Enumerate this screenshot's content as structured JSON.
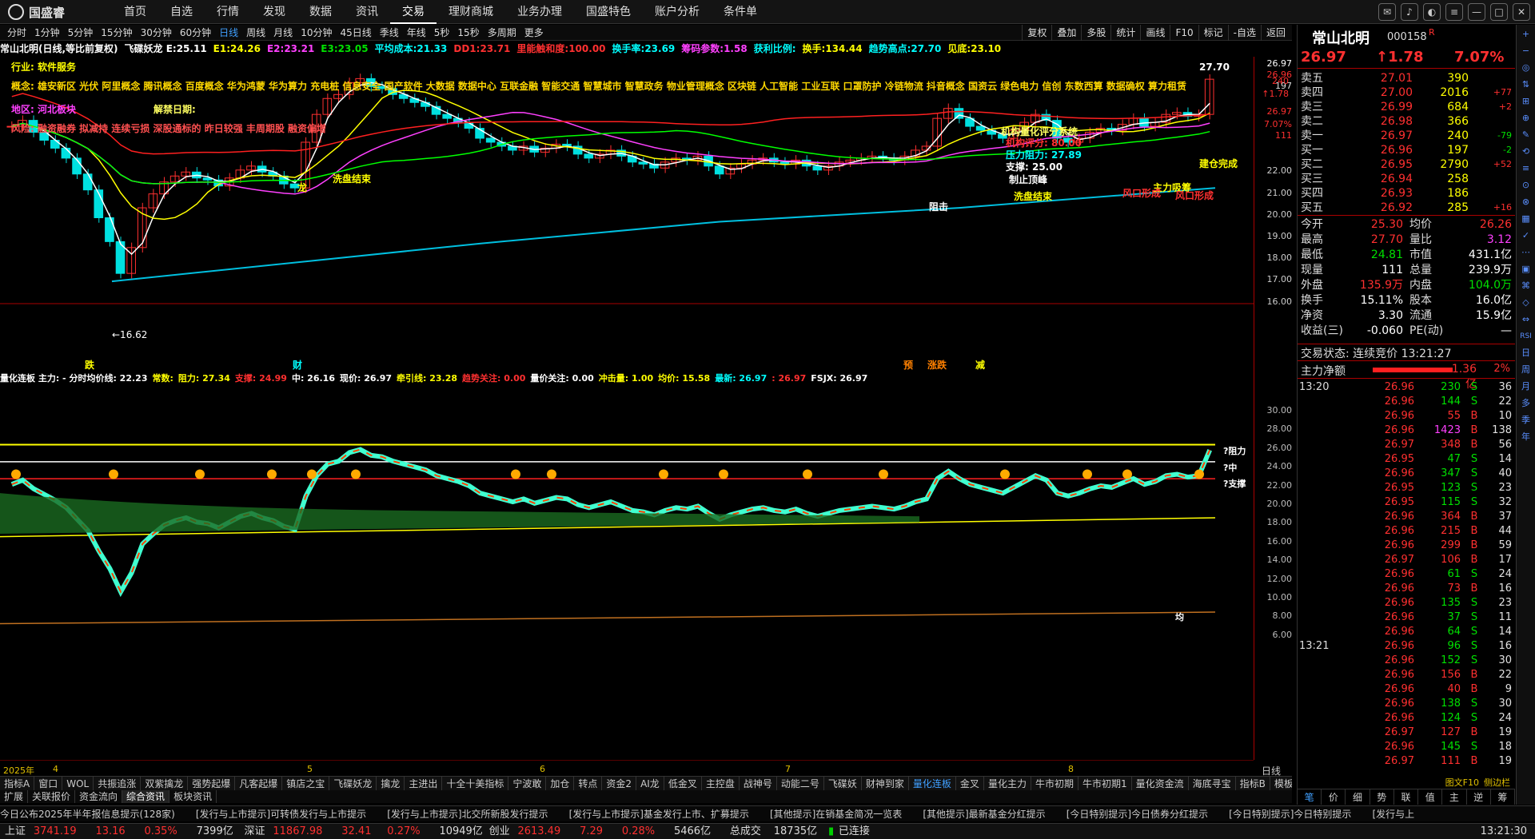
{
  "app": {
    "logo": "国盛睿",
    "menu": [
      "首页",
      "自选",
      "行情",
      "发现",
      "数据",
      "资讯",
      "交易",
      "理财商城",
      "业务办理",
      "国盛特色",
      "账户分析",
      "条件单"
    ],
    "active_menu": 6
  },
  "periods": [
    "分时",
    "1分钟",
    "5分钟",
    "15分钟",
    "30分钟",
    "60分钟",
    "日线",
    "周线",
    "月线",
    "10分钟",
    "45日线",
    "季线",
    "年线",
    "5秒",
    "15秒",
    "多周期",
    "更多"
  ],
  "active_period": 6,
  "tools": [
    "复权",
    "叠加",
    "多股",
    "统计",
    "画线",
    "F10",
    "标记",
    "-自选",
    "返回"
  ],
  "infobar": [
    {
      "t": "常山北明(日线,等比前复权)",
      "c": "wht"
    },
    {
      "t": "飞碟妖龙 E:25.11",
      "c": "wht"
    },
    {
      "t": "E1:24.26",
      "c": "yel"
    },
    {
      "t": "E2:23.21",
      "c": "mag"
    },
    {
      "t": "E3:23.05",
      "c": "grn"
    },
    {
      "t": "平均成本:21.33",
      "c": "cyn"
    },
    {
      "t": "DD1:23.71",
      "c": "red"
    },
    {
      "t": "里能触和度:100.00",
      "c": "red"
    },
    {
      "t": "换手率:23.69",
      "c": "cyn"
    },
    {
      "t": "筹码参数:1.58",
      "c": "mag"
    },
    {
      "t": "获利比例:",
      "c": "cyn"
    },
    {
      "t": "换手:134.44",
      "c": "yel"
    },
    {
      "t": "趋势高点:27.70",
      "c": "cyn"
    },
    {
      "t": "见底:23.10",
      "c": "yel"
    }
  ],
  "annotations": {
    "industry": "行业: 软件服务",
    "concept": "概念: 雄安新区 光伏 阿里概念 腾讯概念 百度概念 华为鸿蒙 华为算力 充电桩 信息安全 国产软件 大数据 数据中心 互联金融 智能交通 智慧城市 智慧政务 物业管理概念 区块链 人工智能 工业互联 口罩防护 冷链物流 抖音概念 国资云 绿色电力 信创 东数西算 数据确权 算力租赁",
    "region": "地区: 河北板块",
    "risk": "风险: 融资融券 拟减持 连续亏损 深股通标的 昨日较强 丰周期股 融资偏增",
    "jiedu": "解禁日期:",
    "xipan1": "洗盘结束",
    "xipan2": "洗盘结束",
    "zhengu": "阻击",
    "zhuli": "主力吸筹",
    "jiancang": "建仓完成",
    "fengkou1": "风口形成",
    "fengkou2": "风口形成",
    "longhu": "龙",
    "sys_title": "机构量化评分系统",
    "sys_score": "机构评分: 80.00",
    "sys_resist": "压力阻力: 27.89",
    "sys_support": "支撑: 25.00",
    "sys_peak": "制止顶峰",
    "hi_label": "27.70",
    "lo_label": "←16.62",
    "markers": [
      "跌",
      "财",
      "预",
      "涨跌",
      "减"
    ]
  },
  "price_axis": [
    "26.97",
    "26.96",
    "197",
    "26.97",
    "7.07%",
    "111",
    "22.00",
    "21.00",
    "20.00",
    "19.00",
    "18.00",
    "17.00",
    "16.00"
  ],
  "top_axis": [
    "240",
    "↑1.78"
  ],
  "sub_axis": [
    "30.00",
    "28.00",
    "26.00",
    "24.00",
    "22.00",
    "20.00",
    "18.00",
    "16.00",
    "14.00",
    "12.00",
    "10.00",
    "8.00",
    "6.00"
  ],
  "subinfo": [
    {
      "t": "量化连板 主力: - 分时均价线: 22.23",
      "c": "wht"
    },
    {
      "t": "常数:",
      "c": "yel"
    },
    {
      "t": "阻力: 27.34",
      "c": "yel"
    },
    {
      "t": "支撑: 24.99",
      "c": "red"
    },
    {
      "t": "中: 26.16",
      "c": "wht"
    },
    {
      "t": "现价: 26.97",
      "c": "wht"
    },
    {
      "t": "牵引线: 23.28",
      "c": "yel"
    },
    {
      "t": "趋势关注: 0.00",
      "c": "red"
    },
    {
      "t": "量价关注: 0.00",
      "c": "wht"
    },
    {
      "t": "冲击量: 1.00",
      "c": "yel"
    },
    {
      "t": "均价: 15.58",
      "c": "yel"
    },
    {
      "t": "最新: 26.97",
      "c": "cyn"
    },
    {
      "t": ": 26.97",
      "c": "red"
    },
    {
      "t": "FSJX: 26.97",
      "c": "wht"
    }
  ],
  "sub_labels": {
    "resist": "阻力",
    "mid": "中",
    "support": "支撑",
    "avg": "均"
  },
  "dates": [
    "2025年",
    "4",
    "5",
    "6",
    "7",
    "8"
  ],
  "indtabs": [
    "指标A",
    "窗口",
    "WOL",
    "共振追涨",
    "双紫擒龙",
    "强势起爆",
    "凡客起爆",
    "镇店之宝",
    "飞碟妖龙",
    "擒龙",
    "主进出",
    "十全十美指标",
    "宁波敢",
    "加仓",
    "转点",
    "资金2",
    "AI龙",
    "低金叉",
    "主控盘",
    "战神号",
    "动能二号",
    "飞碟妖",
    "财神到家",
    "量化连板",
    "金叉",
    "量化主力",
    "牛市初期",
    "牛市初期1",
    "量化资金流",
    "海底寻宝",
    "指标B",
    "模板"
  ],
  "active_ind": 23,
  "bottabs": [
    "扩展",
    "关联报价",
    "资金流向",
    "综合资讯",
    "板块资讯"
  ],
  "active_bottab": 3,
  "news": [
    "今日公布2025年半年报信息提示(128家)",
    "[发行与上市提示]可转债发行与上市提示",
    "[发行与上市提示]北交所新股发行提示",
    "[发行与上市提示]基金发行上市、扩募提示",
    "[其他提示]在销基金简况一览表",
    "[其他提示]最新基金分红提示",
    "[今日特别提示]今日债券分红提示",
    "[今日特别提示]今日特别提示",
    "[发行与上"
  ],
  "status": {
    "sh_name": "上证",
    "sh_val": "3741.19",
    "sh_chg": "13.16",
    "sh_pct": "0.35%",
    "sh_amt": "7399亿",
    "sz_name": "深证",
    "sz_val": "11867.98",
    "sz_chg": "32.41",
    "sz_pct": "0.27%",
    "sz_amt": "10949亿",
    "cy_name": "创业",
    "cy_val": "2613.49",
    "cy_chg": "7.29",
    "cy_pct": "0.28%",
    "cy_amt": "5466亿",
    "total_name": "总成交",
    "total_amt": "18735亿",
    "conn": "已连接",
    "time": "13:21:30"
  },
  "quote": {
    "name": "常山北明",
    "code": "000158",
    "flag": "R",
    "price": "26.97",
    "chg": "↑1.78",
    "pct": "7.07%"
  },
  "orderbook": [
    {
      "l": "卖五",
      "p": "27.01",
      "v": "390",
      "d": ""
    },
    {
      "l": "卖四",
      "p": "27.00",
      "v": "2016",
      "d": "+77"
    },
    {
      "l": "卖三",
      "p": "26.99",
      "v": "684",
      "d": "+2"
    },
    {
      "l": "卖二",
      "p": "26.98",
      "v": "366",
      "d": ""
    },
    {
      "l": "卖一",
      "p": "26.97",
      "v": "240",
      "d": "-79"
    },
    {
      "l": "买一",
      "p": "26.96",
      "v": "197",
      "d": "-2"
    },
    {
      "l": "买二",
      "p": "26.95",
      "v": "2790",
      "d": "+52"
    },
    {
      "l": "买三",
      "p": "26.94",
      "v": "258",
      "d": ""
    },
    {
      "l": "买四",
      "p": "26.93",
      "v": "186",
      "d": ""
    },
    {
      "l": "买五",
      "p": "26.92",
      "v": "285",
      "d": "+16"
    }
  ],
  "stats": [
    {
      "k1": "今开",
      "v1": "25.30",
      "c1": "red",
      "k2": "均价",
      "v2": "26.26",
      "c2": "red"
    },
    {
      "k1": "最高",
      "v1": "27.70",
      "c1": "red",
      "k2": "量比",
      "v2": "3.12",
      "c2": "mag"
    },
    {
      "k1": "最低",
      "v1": "24.81",
      "c1": "grn",
      "k2": "市值",
      "v2": "431.1亿",
      "c2": "wht"
    },
    {
      "k1": "现量",
      "v1": "111",
      "c1": "wht",
      "k2": "总量",
      "v2": "239.9万",
      "c2": "wht"
    },
    {
      "k1": "外盘",
      "v1": "135.9万",
      "c1": "red",
      "k2": "内盘",
      "v2": "104.0万",
      "c2": "grn"
    },
    {
      "k1": "换手",
      "v1": "15.11%",
      "c1": "wht",
      "k2": "股本",
      "v2": "16.0亿",
      "c2": "wht"
    },
    {
      "k1": "净资",
      "v1": "3.30",
      "c1": "wht",
      "k2": "流通",
      "v2": "15.9亿",
      "c2": "wht"
    },
    {
      "k1": "收益(三)",
      "v1": "-0.060",
      "c1": "wht",
      "k2": "PE(动)",
      "v2": "—",
      "c2": "wht"
    }
  ],
  "trade_state": "交易状态: 连续竞价 13:21:27",
  "net_flow": {
    "label": "主力净额",
    "val": "1.36亿",
    "pct": "2%"
  },
  "ticks": [
    {
      "t": "13:20",
      "p": "26.96",
      "v": "230",
      "bs": "S",
      "n": "36"
    },
    {
      "t": "",
      "p": "26.96",
      "v": "144",
      "bs": "S",
      "n": "22"
    },
    {
      "t": "",
      "p": "26.96",
      "v": "55",
      "bs": "B",
      "n": "10"
    },
    {
      "t": "",
      "p": "26.96",
      "v": "1423",
      "bs": "B",
      "n": "138"
    },
    {
      "t": "",
      "p": "26.97",
      "v": "348",
      "bs": "B",
      "n": "56"
    },
    {
      "t": "",
      "p": "26.95",
      "v": "47",
      "bs": "S",
      "n": "14"
    },
    {
      "t": "",
      "p": "26.96",
      "v": "347",
      "bs": "S",
      "n": "40"
    },
    {
      "t": "",
      "p": "26.95",
      "v": "123",
      "bs": "S",
      "n": "23"
    },
    {
      "t": "",
      "p": "26.95",
      "v": "115",
      "bs": "S",
      "n": "32"
    },
    {
      "t": "",
      "p": "26.96",
      "v": "364",
      "bs": "B",
      "n": "37"
    },
    {
      "t": "",
      "p": "26.96",
      "v": "215",
      "bs": "B",
      "n": "44"
    },
    {
      "t": "",
      "p": "26.96",
      "v": "299",
      "bs": "B",
      "n": "59"
    },
    {
      "t": "",
      "p": "26.97",
      "v": "106",
      "bs": "B",
      "n": "17"
    },
    {
      "t": "",
      "p": "26.96",
      "v": "61",
      "bs": "S",
      "n": "24"
    },
    {
      "t": "",
      "p": "26.96",
      "v": "73",
      "bs": "B",
      "n": "16"
    },
    {
      "t": "",
      "p": "26.96",
      "v": "135",
      "bs": "S",
      "n": "23"
    },
    {
      "t": "",
      "p": "26.96",
      "v": "37",
      "bs": "S",
      "n": "11"
    },
    {
      "t": "",
      "p": "26.96",
      "v": "64",
      "bs": "S",
      "n": "14"
    },
    {
      "t": "13:21",
      "p": "26.96",
      "v": "96",
      "bs": "S",
      "n": "16"
    },
    {
      "t": "",
      "p": "26.96",
      "v": "152",
      "bs": "S",
      "n": "30"
    },
    {
      "t": "",
      "p": "26.96",
      "v": "156",
      "bs": "B",
      "n": "22"
    },
    {
      "t": "",
      "p": "26.96",
      "v": "40",
      "bs": "B",
      "n": "9"
    },
    {
      "t": "",
      "p": "26.96",
      "v": "138",
      "bs": "S",
      "n": "30"
    },
    {
      "t": "",
      "p": "26.96",
      "v": "124",
      "bs": "S",
      "n": "24"
    },
    {
      "t": "",
      "p": "26.97",
      "v": "127",
      "bs": "B",
      "n": "19"
    },
    {
      "t": "",
      "p": "26.96",
      "v": "145",
      "bs": "S",
      "n": "18"
    },
    {
      "t": "",
      "p": "26.97",
      "v": "111",
      "bs": "B",
      "n": "19"
    }
  ],
  "right_tabs": [
    "笔",
    "价",
    "细",
    "势",
    "联",
    "值",
    "主",
    "逆",
    "筹"
  ],
  "side_icons": [
    "日",
    "周",
    "月",
    "多",
    "季",
    "年"
  ],
  "side_labels": [
    "RSI"
  ],
  "sub_tab": "图文F10",
  "sub_tab2": "侧边栏"
}
